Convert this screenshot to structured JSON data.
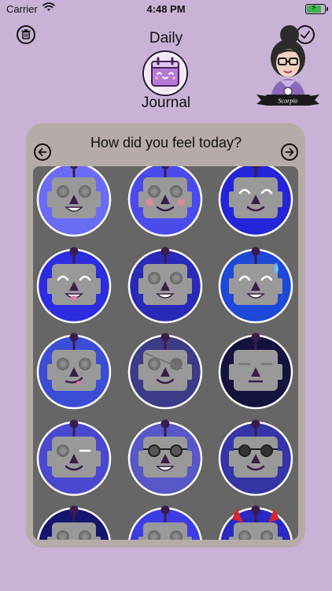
{
  "status_bar": {
    "carrier": "Carrier",
    "time": "4:48 PM",
    "battery_level": 0.9,
    "battery_charging": true
  },
  "header": {
    "title_top": "Daily",
    "title_bottom": "Journal",
    "logo_icon": "calendar-face-icon",
    "avatar_icon": "scorpio-avatar-icon",
    "avatar_banner_text": "Scorpio"
  },
  "actions": {
    "delete_icon": "trash-icon",
    "confirm_icon": "checkmark-icon"
  },
  "prompt": {
    "question": "How did you feel today?",
    "prev_icon": "arrow-left-icon",
    "next_icon": "arrow-right-icon"
  },
  "colors": {
    "background": "#c8b3d6",
    "card": "#b5aba8",
    "grid_panel": "#666666",
    "robot_face": "#999999",
    "robot_features": "#3a1d4a"
  },
  "moods": [
    {
      "bg": "#6a6cf5",
      "eyes": "goggles",
      "mouth": "grin",
      "extra": ""
    },
    {
      "bg": "#4a4bea",
      "eyes": "goggles",
      "mouth": "smile",
      "extra": "blush"
    },
    {
      "bg": "#2424d8",
      "eyes": "happy",
      "mouth": "smile",
      "extra": ""
    },
    {
      "bg": "#2c2ce0",
      "eyes": "happy",
      "mouth": "tongue",
      "extra": ""
    },
    {
      "bg": "#2a2ab8",
      "eyes": "goggles",
      "mouth": "grin",
      "extra": ""
    },
    {
      "bg": "#1e49d8",
      "eyes": "happy",
      "mouth": "grin",
      "extra": "sweat"
    },
    {
      "bg": "#3b4cd6",
      "eyes": "goggles",
      "mouth": "smirk",
      "extra": ""
    },
    {
      "bg": "#3d3a88",
      "eyes": "patch",
      "mouth": "smile",
      "extra": ""
    },
    {
      "bg": "#13133d",
      "eyes": "flat",
      "mouth": "flat",
      "extra": ""
    },
    {
      "bg": "#4a47d0",
      "eyes": "wink",
      "mouth": "smile",
      "extra": ""
    },
    {
      "bg": "#5757c8",
      "eyes": "sunglasses",
      "mouth": "grin",
      "extra": ""
    },
    {
      "bg": "#3535a8",
      "eyes": "glasses",
      "mouth": "smile",
      "extra": ""
    },
    {
      "bg": "#161670",
      "eyes": "goggles",
      "mouth": "smile",
      "extra": ""
    },
    {
      "bg": "#3d3de6",
      "eyes": "goggles",
      "mouth": "smile",
      "extra": ""
    },
    {
      "bg": "#2a2ac2",
      "eyes": "goggles",
      "mouth": "smile",
      "extra": "horns"
    }
  ]
}
